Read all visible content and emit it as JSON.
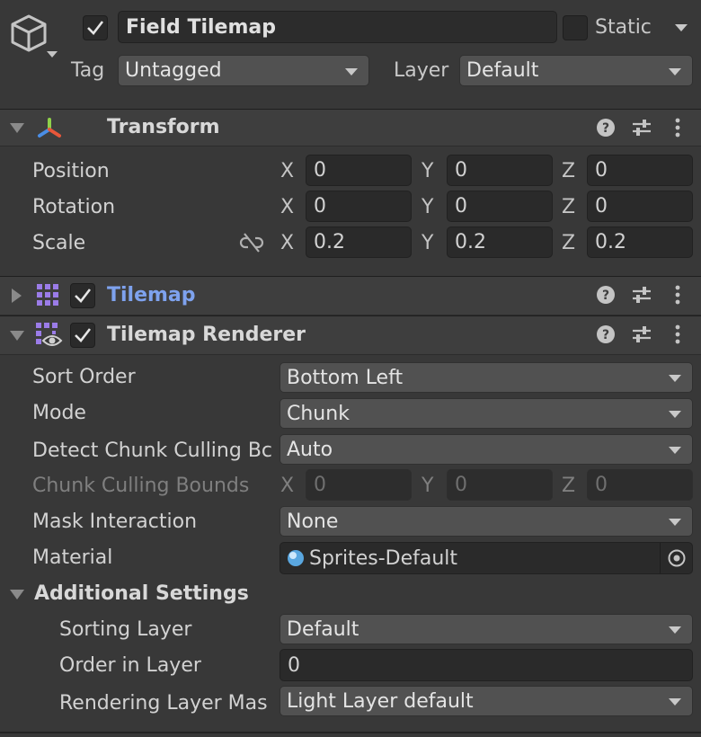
{
  "object": {
    "name": "Field Tilemap",
    "static_label": "Static",
    "tag_label": "Tag",
    "tag_value": "Untagged",
    "layer_label": "Layer",
    "layer_value": "Default",
    "icon": "cube-icon"
  },
  "transform": {
    "title": "Transform",
    "rows": [
      {
        "label": "Position",
        "x": "0",
        "y": "0",
        "z": "0"
      },
      {
        "label": "Rotation",
        "x": "0",
        "y": "0",
        "z": "0"
      },
      {
        "label": "Scale",
        "x": "0.2",
        "y": "0.2",
        "z": "0.2"
      }
    ],
    "axis": {
      "x": "X",
      "y": "Y",
      "z": "Z"
    }
  },
  "tilemap": {
    "title": "Tilemap",
    "title_color": "#7ea2ee"
  },
  "renderer": {
    "title": "Tilemap Renderer",
    "sort_order": {
      "label": "Sort Order",
      "value": "Bottom Left"
    },
    "mode": {
      "label": "Mode",
      "value": "Chunk"
    },
    "detect_culling": {
      "label": "Detect Chunk Culling Bc",
      "value": "Auto"
    },
    "culling_bounds": {
      "label": "Chunk Culling Bounds",
      "x": "0",
      "y": "0",
      "z": "0"
    },
    "mask_interaction": {
      "label": "Mask Interaction",
      "value": "None"
    },
    "material": {
      "label": "Material",
      "value": "Sprites-Default"
    },
    "additional": {
      "title": "Additional Settings",
      "sorting_layer": {
        "label": "Sorting Layer",
        "value": "Default"
      },
      "order_in_layer": {
        "label": "Order in Layer",
        "value": "0"
      },
      "rendering_layer_mask": {
        "label": "Rendering Layer Mas",
        "value": "Light Layer default"
      }
    }
  },
  "colors": {
    "background": "#383838",
    "header": "#3e3e3e",
    "field": "#2a2a2a",
    "dropdown": "#515151",
    "accent_blue": "#7ea2ee"
  }
}
